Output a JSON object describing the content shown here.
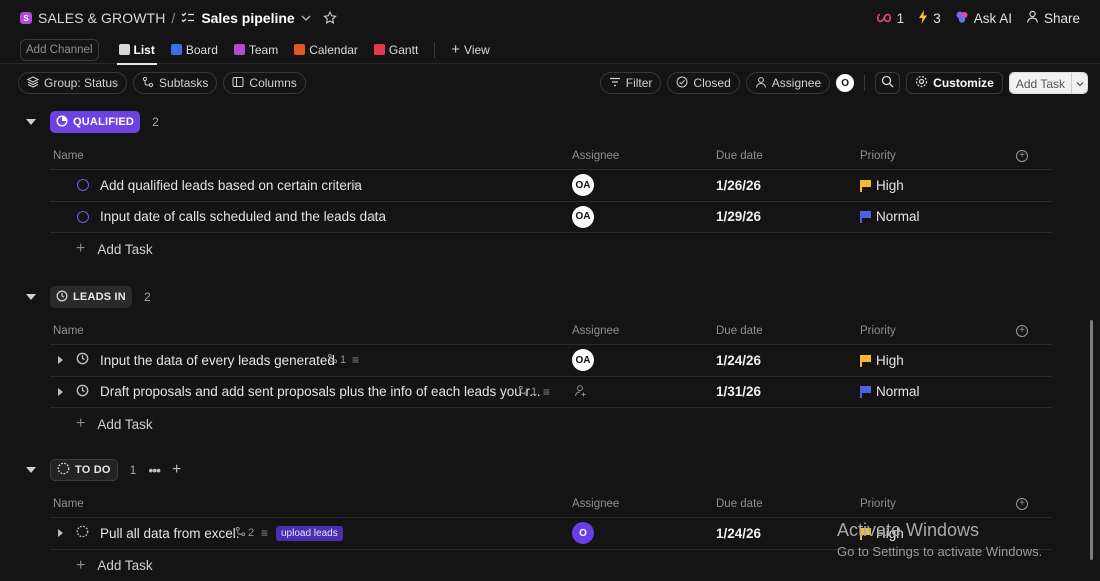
{
  "topbar": {
    "space_badge": "S",
    "space": "SALES & GROWTH",
    "separator": "/",
    "page": "Sales pipeline",
    "icons": [
      "checklist-icon",
      "chevron-down-icon",
      "star-icon"
    ],
    "infinity_count": "1",
    "bolt_count": "3",
    "ask_ai": "Ask AI",
    "share": "Share"
  },
  "views": {
    "add_channel": "Add Channel",
    "tabs": [
      {
        "label": "List",
        "color": "#d8d8d8"
      },
      {
        "label": "Board",
        "color": "#3b6ee8"
      },
      {
        "label": "Team",
        "color": "#b44bd0"
      },
      {
        "label": "Calendar",
        "color": "#e0582a"
      },
      {
        "label": "Gantt",
        "color": "#e23b4c"
      }
    ],
    "add_view": "View"
  },
  "toolbar": {
    "group": "Group: Status",
    "subtasks": "Subtasks",
    "columns": "Columns",
    "filter": "Filter",
    "closed": "Closed",
    "assignee": "Assignee",
    "me_initial": "O",
    "customize": "Customize",
    "add_task": "Add Task"
  },
  "columns": {
    "name": "Name",
    "assignee": "Assignee",
    "due": "Due date",
    "priority": "Priority"
  },
  "colors": {
    "qualified": "#6c43e0",
    "high": "#f5b82e",
    "normal": "#4a61e8",
    "tag": "#4b2fb1"
  },
  "groups": [
    {
      "label": "QUALIFIED",
      "count": "2",
      "tasks": [
        {
          "name": "Add qualified leads based on certain criteria",
          "assignee": "OA",
          "due": "1/26/26",
          "priority": "High"
        },
        {
          "name": "Input date of calls scheduled and the leads data",
          "assignee": "OA",
          "due": "1/29/26",
          "priority": "Normal"
        }
      ],
      "add_task": "Add Task"
    },
    {
      "label": "LEADS IN",
      "count": "2",
      "tasks": [
        {
          "name": "Input the data of every leads generated",
          "subtasks": "1",
          "assignee": "OA",
          "due": "1/24/26",
          "priority": "High"
        },
        {
          "name": "Draft proposals and add sent proposals plus the info of each leads you r...",
          "subtasks": "1",
          "assignee": "",
          "due": "1/31/26",
          "priority": "Normal"
        }
      ],
      "add_task": "Add Task"
    },
    {
      "label": "TO DO",
      "count": "1",
      "tasks": [
        {
          "name": "Pull all data from excel.",
          "subtasks": "2",
          "tag": "upload leads",
          "assignee": "O",
          "due": "1/24/26",
          "priority": "High"
        }
      ],
      "add_task": "Add Task"
    }
  ],
  "watermark": {
    "title": "Activate Windows",
    "subtitle": "Go to Settings to activate Windows."
  }
}
